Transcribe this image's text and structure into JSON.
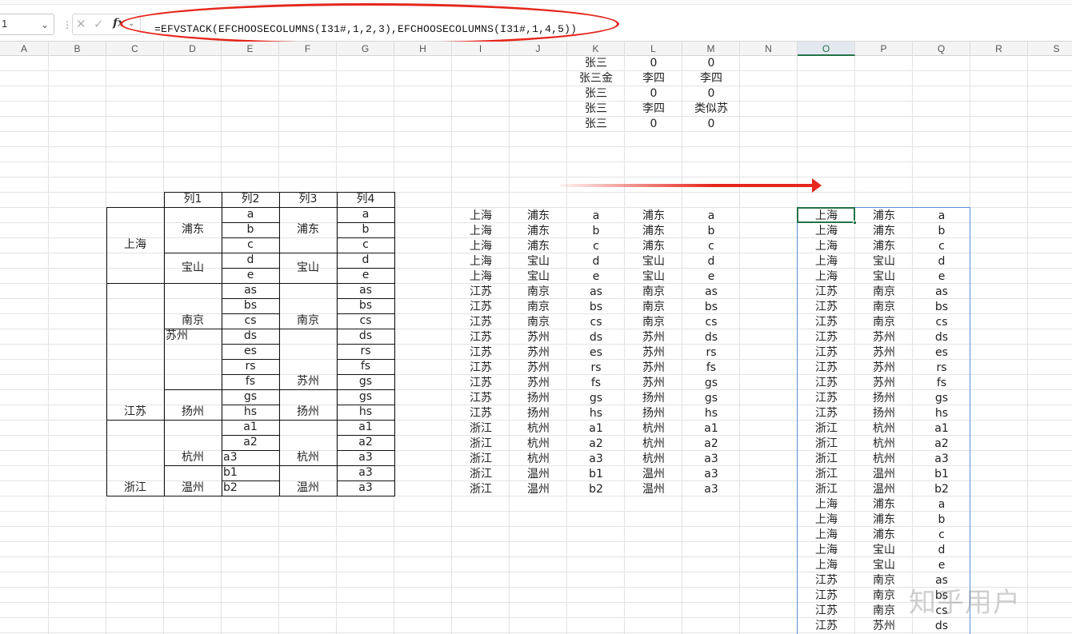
{
  "name_box": {
    "value": "1"
  },
  "formula_bar": {
    "formula": "=EFVSTACK(EFCHOOSECOLUMNS(I31#,1,2,3),EFCHOOSECOLUMNS(I31#,1,4,5))",
    "fx_label": "fx",
    "cancel_glyph": "✕",
    "confirm_glyph": "✓"
  },
  "columns": [
    "A",
    "B",
    "C",
    "D",
    "E",
    "F",
    "G",
    "H",
    "I",
    "J",
    "K",
    "L",
    "M",
    "N",
    "O",
    "P",
    "Q",
    "R",
    "S"
  ],
  "selected_column": "O",
  "top_block": [
    [
      "张三",
      "0",
      "0"
    ],
    [
      "张三金",
      "李四",
      "李四"
    ],
    [
      "张三",
      "0",
      "0"
    ],
    [
      "张三",
      "李四",
      "类似苏"
    ],
    [
      "张三",
      "0",
      "0"
    ]
  ],
  "merged_table": {
    "headers": [
      "列1",
      "列2",
      "列3",
      "列4"
    ],
    "provinces": [
      "上海",
      "江苏",
      "浙江"
    ],
    "cities_col1": [
      "浦东",
      "宝山",
      "南京",
      "苏州",
      "扬州",
      "杭州",
      "温州"
    ],
    "col2": [
      "a",
      "b",
      "c",
      "d",
      "e",
      "as",
      "bs",
      "cs",
      "ds",
      "es",
      "rs",
      "fs",
      "gs",
      "hs",
      "a1",
      "a2",
      "a3",
      "b1",
      "b2"
    ],
    "cities_col3": [
      "浦东",
      "宝山",
      "南京",
      "苏州",
      "扬州",
      "杭州",
      "温州"
    ],
    "col4": [
      "a",
      "b",
      "c",
      "d",
      "e",
      "as",
      "bs",
      "cs",
      "ds",
      "rs",
      "fs",
      "gs",
      "gs",
      "hs",
      "a1",
      "a2",
      "a3",
      "a3",
      "a3"
    ]
  },
  "middle_rows": [
    [
      "上海",
      "浦东",
      "a",
      "浦东",
      "a"
    ],
    [
      "上海",
      "浦东",
      "b",
      "浦东",
      "b"
    ],
    [
      "上海",
      "浦东",
      "c",
      "浦东",
      "c"
    ],
    [
      "上海",
      "宝山",
      "d",
      "宝山",
      "d"
    ],
    [
      "上海",
      "宝山",
      "e",
      "宝山",
      "e"
    ],
    [
      "江苏",
      "南京",
      "as",
      "南京",
      "as"
    ],
    [
      "江苏",
      "南京",
      "bs",
      "南京",
      "bs"
    ],
    [
      "江苏",
      "南京",
      "cs",
      "南京",
      "cs"
    ],
    [
      "江苏",
      "苏州",
      "ds",
      "苏州",
      "ds"
    ],
    [
      "江苏",
      "苏州",
      "es",
      "苏州",
      "rs"
    ],
    [
      "江苏",
      "苏州",
      "rs",
      "苏州",
      "fs"
    ],
    [
      "江苏",
      "苏州",
      "fs",
      "苏州",
      "gs"
    ],
    [
      "江苏",
      "扬州",
      "gs",
      "扬州",
      "gs"
    ],
    [
      "江苏",
      "扬州",
      "hs",
      "扬州",
      "hs"
    ],
    [
      "浙江",
      "杭州",
      "a1",
      "杭州",
      "a1"
    ],
    [
      "浙江",
      "杭州",
      "a2",
      "杭州",
      "a2"
    ],
    [
      "浙江",
      "杭州",
      "a3",
      "杭州",
      "a3"
    ],
    [
      "浙江",
      "温州",
      "b1",
      "温州",
      "a3"
    ],
    [
      "浙江",
      "温州",
      "b2",
      "温州",
      "a3"
    ]
  ],
  "right_rows": [
    [
      "上海",
      "浦东",
      "a"
    ],
    [
      "上海",
      "浦东",
      "b"
    ],
    [
      "上海",
      "浦东",
      "c"
    ],
    [
      "上海",
      "宝山",
      "d"
    ],
    [
      "上海",
      "宝山",
      "e"
    ],
    [
      "江苏",
      "南京",
      "as"
    ],
    [
      "江苏",
      "南京",
      "bs"
    ],
    [
      "江苏",
      "南京",
      "cs"
    ],
    [
      "江苏",
      "苏州",
      "ds"
    ],
    [
      "江苏",
      "苏州",
      "es"
    ],
    [
      "江苏",
      "苏州",
      "rs"
    ],
    [
      "江苏",
      "苏州",
      "fs"
    ],
    [
      "江苏",
      "扬州",
      "gs"
    ],
    [
      "江苏",
      "扬州",
      "hs"
    ],
    [
      "浙江",
      "杭州",
      "a1"
    ],
    [
      "浙江",
      "杭州",
      "a2"
    ],
    [
      "浙江",
      "杭州",
      "a3"
    ],
    [
      "浙江",
      "温州",
      "b1"
    ],
    [
      "浙江",
      "温州",
      "b2"
    ],
    [
      "上海",
      "浦东",
      "a"
    ],
    [
      "上海",
      "浦东",
      "b"
    ],
    [
      "上海",
      "浦东",
      "c"
    ],
    [
      "上海",
      "宝山",
      "d"
    ],
    [
      "上海",
      "宝山",
      "e"
    ],
    [
      "江苏",
      "南京",
      "as"
    ],
    [
      "江苏",
      "南京",
      "bs"
    ],
    [
      "江苏",
      "南京",
      "cs"
    ],
    [
      "江苏",
      "苏州",
      "ds"
    ]
  ],
  "watermark": "知乎用户",
  "colors": {
    "accent_green": "#217346",
    "annotation_red": "#e5271d",
    "spill_blue": "#5b8fd6"
  }
}
